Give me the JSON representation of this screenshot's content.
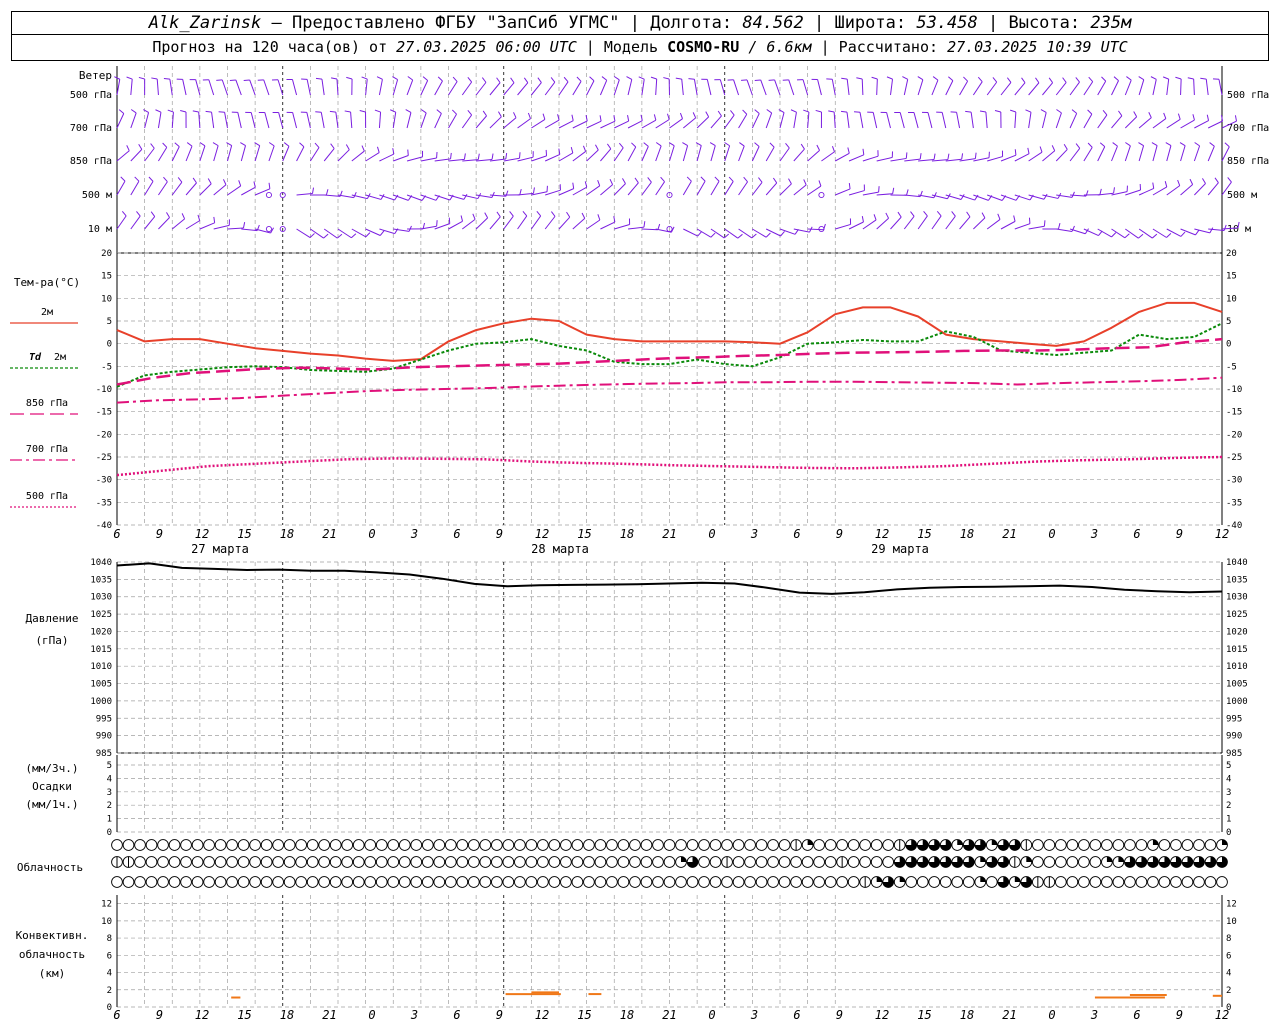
{
  "header": {
    "station": "Alk_Zarinsk",
    "provider": " – Предоставлено ФГБУ \"ЗапСиб УГМС\" | Долгота: ",
    "lon": "84.562",
    "lat_label": " | Широта: ",
    "lat": "53.458",
    "alt_label": " | Высота: ",
    "alt": "235м",
    "forecast_label": "Прогноз на 120 часа(ов) от ",
    "forecast_time": "27.03.2025 06:00 UTC",
    "model_label": "  | Модель ",
    "model": "COSMO-RU",
    "resolution": " / 6.6км",
    "calc_label": " | Рассчитано: ",
    "calc_time": "27.03.2025 10:39 UTC"
  },
  "colors": {
    "t2m": "#e8402a",
    "td2m": "#0a8a0a",
    "t850": "#e0107a",
    "t700": "#e0107a",
    "t500": "#e0107a",
    "wind": "#7a1ee0",
    "pressure": "#000000",
    "convective": "#f07818",
    "grid": "#a0a0a0"
  },
  "chart_data": {
    "type": "line",
    "x_hours": [
      6,
      9,
      12,
      15,
      18,
      21,
      0,
      3,
      6,
      9,
      12,
      15,
      18,
      21,
      0,
      3,
      6,
      9,
      12,
      15,
      18,
      21,
      0,
      3,
      6,
      9,
      12
    ],
    "day_labels": [
      {
        "label": "27 марта",
        "x_index": 2
      },
      {
        "label": "28 марта",
        "x_index": 10
      },
      {
        "label": "29 марта",
        "x_index": 18
      }
    ],
    "wind": {
      "title": "Ветер",
      "levels": [
        "500 гПа",
        "700 гПа",
        "850 гПа",
        "500 м",
        "10  м"
      ],
      "calm_symbol": "calm-circle-icon"
    },
    "temperature": {
      "title": "Тем-ра(°С)",
      "ylim": [
        -40,
        20
      ],
      "ticks": [
        20,
        15,
        10,
        5,
        0,
        -5,
        -10,
        -15,
        -20,
        -25,
        -30,
        -35,
        -40
      ],
      "series": [
        {
          "name": "2м",
          "label_prefix": "",
          "values": [
            3,
            0.5,
            1,
            1,
            0,
            -1,
            -1.6,
            -2.2,
            -2.6,
            -3.3,
            -3.8,
            -3.4,
            0.5,
            3,
            4.5,
            5.5,
            5,
            2,
            1,
            0.5,
            0.5,
            0.5,
            0.5,
            0.3,
            0,
            2.5,
            6.5,
            8,
            8,
            6,
            2,
            1,
            0.5,
            0,
            -0.5,
            0.5,
            3.5,
            7,
            9,
            9,
            7
          ]
        },
        {
          "name": "2м",
          "label_prefix": "Td",
          "values": [
            -9.5,
            -7,
            -6.2,
            -5.7,
            -5.2,
            -5,
            -5.2,
            -5.8,
            -6,
            -6.2,
            -5.5,
            -3.5,
            -1.5,
            0,
            0.3,
            1,
            -0.5,
            -1.5,
            -4,
            -4.5,
            -4.5,
            -3.5,
            -4.5,
            -5,
            -3,
            0,
            0.3,
            0.8,
            0.5,
            0.5,
            2.7,
            1.5,
            -1.5,
            -2,
            -2.5,
            -2,
            -1.5,
            2,
            1,
            1.5,
            4.5
          ]
        },
        {
          "name": "850 гПа",
          "label_prefix": "",
          "values": [
            -9,
            -7.5,
            -6.5,
            -6,
            -5.5,
            -5.3,
            -5.5,
            -5.7,
            -5.2,
            -5,
            -4.8,
            -4.6,
            -4.4,
            -4,
            -3.6,
            -3.2,
            -3,
            -2.7,
            -2.5,
            -2.2,
            -2,
            -1.9,
            -1.8,
            -1.6,
            -1.5,
            -1.5,
            -1.3,
            -1,
            -0.8,
            0.3,
            1
          ]
        },
        {
          "name": "700 гПа",
          "label_prefix": "",
          "values": [
            -13,
            -12.5,
            -12.3,
            -12,
            -11.5,
            -11,
            -10.5,
            -10.2,
            -10,
            -9.8,
            -9.5,
            -9.2,
            -9,
            -8.8,
            -8.7,
            -8.5,
            -8.5,
            -8.4,
            -8.4,
            -8.5,
            -8.6,
            -8.7,
            -9,
            -8.7,
            -8.5,
            -8.3,
            -8,
            -7.5
          ]
        },
        {
          "name": "500 гПа",
          "label_prefix": "",
          "values": [
            -29,
            -28,
            -27,
            -26.5,
            -26,
            -25.5,
            -25.3,
            -25.4,
            -25.5,
            -26,
            -26.3,
            -26.5,
            -26.8,
            -27,
            -27.2,
            -27.4,
            -27.5,
            -27.3,
            -27,
            -26.5,
            -26,
            -25.7,
            -25.5,
            -25.2,
            -25
          ]
        }
      ]
    },
    "pressure": {
      "title": "Давление",
      "unit": "(гПа)",
      "ylim": [
        985,
        1040
      ],
      "ticks": [
        1040,
        1035,
        1030,
        1025,
        1020,
        1015,
        1010,
        1005,
        1000,
        995,
        990,
        985
      ],
      "values": [
        1039,
        1039.6,
        1038.3,
        1038,
        1037.7,
        1037.8,
        1037.5,
        1037.5,
        1037,
        1036.4,
        1035.2,
        1033.7,
        1033,
        1033.3,
        1033.4,
        1033.5,
        1033.6,
        1033.8,
        1034,
        1033.8,
        1032.6,
        1031.2,
        1030.8,
        1031.3,
        1032.1,
        1032.6,
        1032.8,
        1032.9,
        1033,
        1033.2,
        1032.8,
        1032,
        1031.6,
        1031.3,
        1031.5
      ]
    },
    "precipitation": {
      "unit_top": "(мм/3ч.)",
      "title": "Осадки",
      "unit_bottom": "(мм/1ч.)",
      "ylim": [
        0,
        5
      ],
      "ticks": [
        5,
        4,
        3,
        2,
        1,
        0
      ]
    },
    "cloudiness": {
      "title": "Облачность",
      "rows": [
        "0000000000000000000000000000000000000000000000000000000000000000000000000000000000000000000000000000000000000000000000000000000000000000000000000000000000000000000000000000000000000000000000000000000000000000000000000000000000000000000000000000000000000000000000000000000000000000",
        "0000000000000000000000000000000000000000000000000000000000000000000000000000000000000000000000000000000000000000000000000000000000000000000000000000000000000000000000000000000000000000000000000000000000000000000000000000000000000000000000000000000000000000000000000000000000000000",
        "0000000000000000000000000000000000000000000000000000000000000000000000000000000000000000000000000000000000000000000000000000000000000000000000000000000000000000000000000000000000000000000000000000000000000000000000000000000000000000000000000000000000000000000000000000000000000000"
      ]
    },
    "convective": {
      "title_1": "Конвективн.",
      "title_2": "облачность",
      "unit": "(км)",
      "ylim": [
        0,
        13
      ],
      "ticks": [
        12,
        10,
        8,
        6,
        4,
        2,
        0
      ],
      "segments": [
        {
          "x_start": 12.4,
          "x_end": 13.4,
          "y": 1.1
        },
        {
          "x_start": 42.2,
          "x_end": 48.2,
          "y": 1.5
        },
        {
          "x_start": 45.0,
          "x_end": 48.0,
          "y": 1.7
        },
        {
          "x_start": 51.2,
          "x_end": 52.6,
          "y": 1.5
        },
        {
          "x_start": 106.2,
          "x_end": 113.8,
          "y": 1.1
        },
        {
          "x_start": 110.0,
          "x_end": 114.0,
          "y": 1.4
        },
        {
          "x_start": 119.0,
          "x_end": 120.0,
          "y": 1.3
        }
      ]
    }
  }
}
